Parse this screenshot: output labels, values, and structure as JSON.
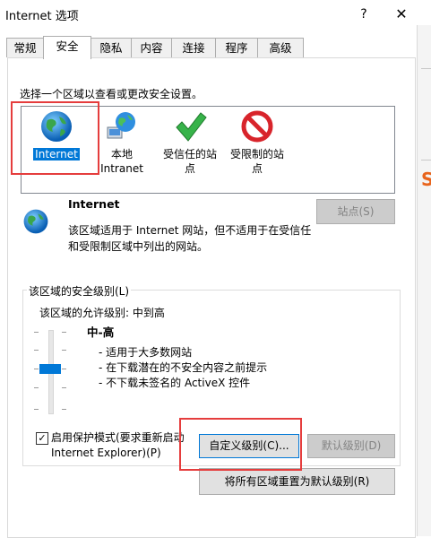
{
  "window": {
    "title": "Internet 选项",
    "help_label": "?",
    "close_label": "✕"
  },
  "tabs": [
    {
      "label": "常规"
    },
    {
      "label": "安全"
    },
    {
      "label": "隐私"
    },
    {
      "label": "内容"
    },
    {
      "label": "连接"
    },
    {
      "label": "程序"
    },
    {
      "label": "高级"
    }
  ],
  "active_tab": "安全",
  "zones": {
    "prompt": "选择一个区域以查看或更改安全设置。",
    "items": [
      {
        "label": "Internet",
        "icon": "globe-icon",
        "selected": true
      },
      {
        "label_line1": "本地",
        "label_line2": "Intranet",
        "icon": "intranet-globe-icon"
      },
      {
        "label_line1": "受信任的站",
        "label_line2": "点",
        "icon": "green-check-icon"
      },
      {
        "label_line1": "受限制的站",
        "label_line2": "点",
        "icon": "red-prohibited-icon"
      }
    ]
  },
  "info": {
    "title": "Internet",
    "description": "该区域适用于 Internet 网站，但不适用于在受信任和受限制区域中列出的网站。",
    "sites_button": "站点(S)"
  },
  "security_level": {
    "legend": "该区域的安全级别(L)",
    "allowed_levels": "该区域的允许级别: 中到高",
    "level_name": "中-高",
    "level_value": "中-高",
    "descriptions": [
      "- 适用于大多数网站",
      "- 在下载潜在的不安全内容之前提示",
      "- 不下载未签名的 ActiveX 控件"
    ],
    "protected_mode_checked": true,
    "protected_mode_label": "启用保护模式(要求重新启动 Internet Explorer)(P)",
    "custom_button": "自定义级别(C)...",
    "default_button": "默认级别(D)",
    "reset_button": "将所有区域重置为默认级别(R)"
  },
  "colors": {
    "accent": "#0078d7",
    "highlight": "#e53d3d",
    "disabled_text": "#838383"
  }
}
